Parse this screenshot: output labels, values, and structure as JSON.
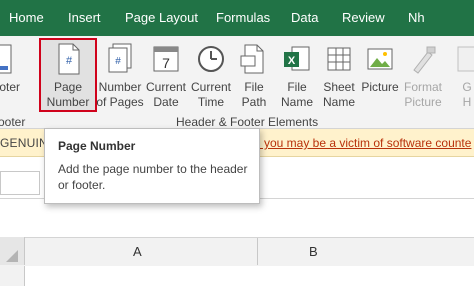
{
  "tabs": [
    "Home",
    "Insert",
    "Page Layout",
    "Formulas",
    "Data",
    "Review",
    "Nh"
  ],
  "ribbon": {
    "partial_left": "ooter",
    "partial_left_bottom": "ooter",
    "buttons": [
      {
        "line1": "Page",
        "line2": "Number",
        "icon": "page-number-icon"
      },
      {
        "line1": "Number",
        "line2": "of Pages",
        "icon": "number-of-pages-icon"
      },
      {
        "line1": "Current",
        "line2": "Date",
        "icon": "current-date-icon"
      },
      {
        "line1": "Current",
        "line2": "Time",
        "icon": "current-time-icon"
      },
      {
        "line1": "File",
        "line2": "Path",
        "icon": "file-path-icon"
      },
      {
        "line1": "File",
        "line2": "Name",
        "icon": "file-name-icon"
      },
      {
        "line1": "Sheet",
        "line2": "Name",
        "icon": "sheet-name-icon"
      },
      {
        "line1": "Picture",
        "line2": "",
        "icon": "picture-icon"
      },
      {
        "line1": "Format",
        "line2": "Picture",
        "icon": "format-picture-icon"
      },
      {
        "line1": "G",
        "line2": "H",
        "icon": "go-to-header-icon"
      }
    ],
    "group_label": "Header & Footer Elements",
    "calendar_day": "7",
    "page_hash": "#"
  },
  "warning": {
    "left_text": "GENUIN",
    "right_text": "l you may be a victim of software counte"
  },
  "tooltip": {
    "title": "Page Number",
    "body": "Add the page number to the header or footer."
  },
  "columns": [
    "A",
    "B"
  ],
  "colors": {
    "tab_bar": "#217346",
    "highlight_box": "#d0021b",
    "warning_bg": "#fff2cc",
    "warning_link": "#b8310b"
  }
}
